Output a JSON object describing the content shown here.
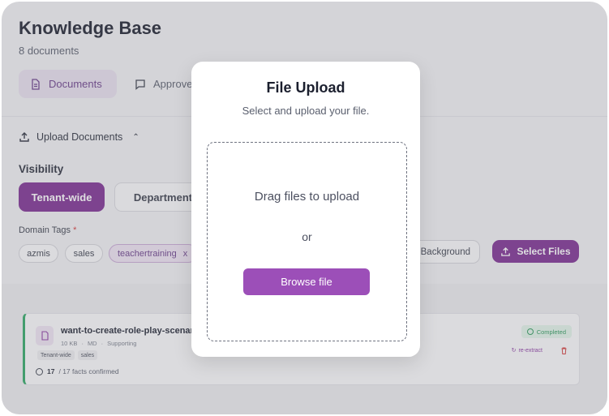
{
  "header": {
    "title": "Knowledge Base",
    "subtitle": "8 documents"
  },
  "tabs": [
    {
      "label": "Documents",
      "icon": "document-icon"
    },
    {
      "label": "Approve",
      "icon": "chat-icon"
    }
  ],
  "upload_section": {
    "title": "Upload Documents",
    "visibility_label": "Visibility",
    "visibility_options": [
      "Tenant-wide",
      "Department"
    ],
    "domain_tags_label": "Domain Tags",
    "required_mark": "*",
    "tags": [
      "azmis",
      "sales",
      "teachertraining"
    ],
    "tag_remove": "x",
    "background_label": "Background",
    "select_files_label": "Select Files"
  },
  "document": {
    "name": "want-to-create-role-play-scenario",
    "size": "10 KB",
    "format": "MD",
    "category": "Supporting",
    "tags": [
      "Tenant-wide",
      "sales"
    ],
    "facts_count": "17",
    "facts_text": "/ 17 facts confirmed",
    "status": "Completed",
    "extract_label": "re-extract"
  },
  "modal": {
    "title": "File Upload",
    "subtitle": "Select and upload your file.",
    "drag_text": "Drag files to upload",
    "or_text": "or",
    "browse_label": "Browse file"
  },
  "colors": {
    "primary": "#7d2f92",
    "browse_button": "#9c4fb8",
    "success": "#2fa864"
  }
}
